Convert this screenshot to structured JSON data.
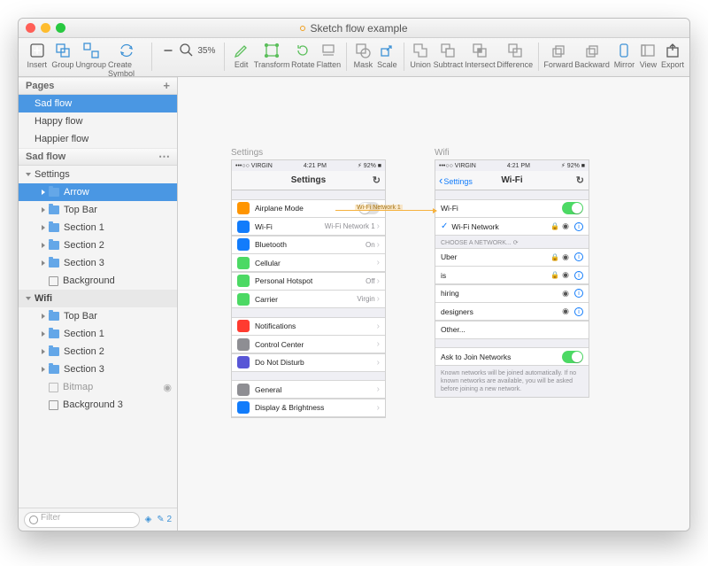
{
  "window_title": "Sketch flow example",
  "toolbar": {
    "insert": "Insert",
    "group": "Group",
    "ungroup": "Ungroup",
    "create_symbol": "Create Symbol",
    "zoom_pct": "35%",
    "edit": "Edit",
    "transform": "Transform",
    "rotate": "Rotate",
    "flatten": "Flatten",
    "mask": "Mask",
    "scale": "Scale",
    "union": "Union",
    "subtract": "Subtract",
    "intersect": "Intersect",
    "difference": "Difference",
    "forward": "Forward",
    "backward": "Backward",
    "mirror": "Mirror",
    "view": "View",
    "export": "Export"
  },
  "sidebar": {
    "pages_header": "Pages",
    "pages": [
      "Sad flow",
      "Happy flow",
      "Happier flow"
    ],
    "artboard1": "Sad flow",
    "group1": "Settings",
    "group1_items": [
      "Arrow",
      "Top Bar",
      "Section 1",
      "Section 2",
      "Section 3",
      "Background"
    ],
    "group2": "Wifi",
    "group2_items": [
      "Top Bar",
      "Section 1",
      "Section 2",
      "Section 3",
      "Bitmap",
      "Background 3"
    ],
    "filter_placeholder": "Filter",
    "layer_count": "2"
  },
  "artboards": {
    "settings": {
      "label": "Settings",
      "status_left": "•••○○ VIRGIN",
      "status_time": "4:21 PM",
      "status_right": "92%",
      "nav_title": "Settings",
      "sec1": [
        {
          "icon": "#ff9500",
          "label": "Airplane Mode",
          "type": "switch",
          "on": false
        },
        {
          "icon": "#127cfb",
          "label": "Wi-Fi",
          "value": "Wi-Fi Network 1",
          "type": "link"
        },
        {
          "icon": "#127cfb",
          "label": "Bluetooth",
          "value": "On",
          "type": "link"
        },
        {
          "icon": "#4cd964",
          "label": "Cellular",
          "type": "link"
        },
        {
          "icon": "#4cd964",
          "label": "Personal Hotspot",
          "value": "Off",
          "type": "link"
        },
        {
          "icon": "#4cd964",
          "label": "Carrier",
          "value": "Virgin",
          "type": "link"
        }
      ],
      "sec2": [
        {
          "icon": "#ff3b30",
          "label": "Notifications",
          "type": "link"
        },
        {
          "icon": "#8e8e93",
          "label": "Control Center",
          "type": "link"
        },
        {
          "icon": "#5856d6",
          "label": "Do Not Disturb",
          "type": "link"
        }
      ],
      "sec3": [
        {
          "icon": "#8e8e93",
          "label": "General",
          "type": "link"
        },
        {
          "icon": "#127cfb",
          "label": "Display & Brightness",
          "type": "link"
        }
      ]
    },
    "wifi": {
      "label": "Wifi",
      "status_left": "•••○○ VIRGIN",
      "status_time": "4:21 PM",
      "status_right": "92%",
      "nav_back": "Settings",
      "nav_title": "Wi-Fi",
      "sec1": [
        {
          "label": "Wi-Fi",
          "type": "switch",
          "on": true
        },
        {
          "label": "Wi-Fi Network",
          "checked": true,
          "lock": true,
          "signal": true,
          "info": true
        }
      ],
      "choose_header": "CHOOSE A NETWORK...",
      "networks": [
        {
          "label": "Uber",
          "lock": true,
          "signal": true,
          "info": true
        },
        {
          "label": "is",
          "lock": true,
          "signal": true,
          "info": true
        },
        {
          "label": "hiring",
          "lock": false,
          "signal": true,
          "info": true
        },
        {
          "label": "designers",
          "lock": false,
          "signal": true,
          "info": true
        },
        {
          "label": "Other..."
        }
      ],
      "ask_label": "Ask to Join Networks",
      "ask_on": true,
      "ask_footer": "Known networks will be joined automatically. If no known networks are available, you will be asked before joining a new network."
    },
    "arrow_label": "Wi-Fi Network 1"
  }
}
